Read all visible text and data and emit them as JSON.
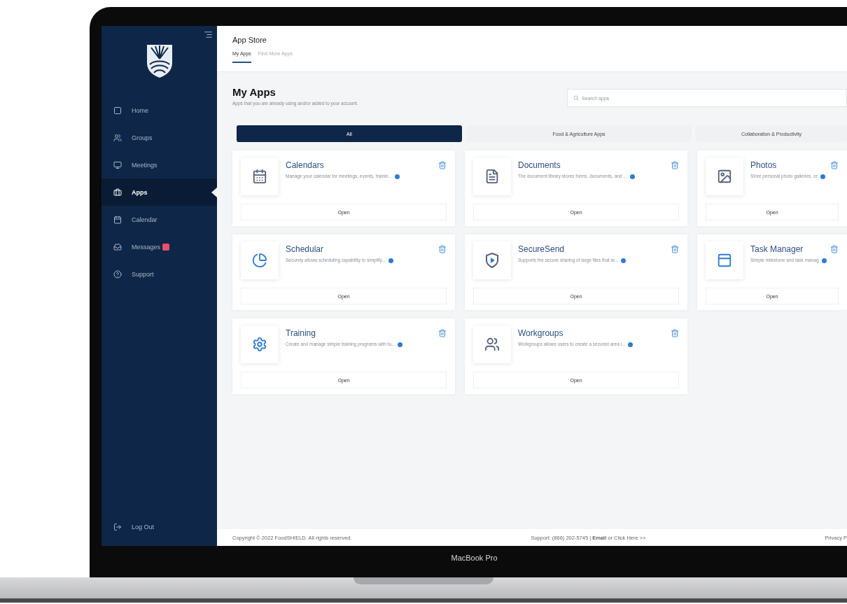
{
  "sidebar": {
    "items": [
      {
        "label": "Home",
        "kind": "home",
        "selected": false,
        "badge": false
      },
      {
        "label": "Groups",
        "kind": "groups",
        "selected": false,
        "badge": false
      },
      {
        "label": "Meetings",
        "kind": "meetings",
        "selected": false,
        "badge": false
      },
      {
        "label": "Apps",
        "kind": "apps",
        "selected": true,
        "badge": false
      },
      {
        "label": "Calendar",
        "kind": "calendar",
        "selected": false,
        "badge": false
      },
      {
        "label": "Messages",
        "kind": "messages",
        "selected": false,
        "badge": true
      },
      {
        "label": "Support",
        "kind": "support",
        "selected": false,
        "badge": false
      }
    ],
    "logout": "Log Out"
  },
  "header": {
    "title": "App Store",
    "tabs": [
      {
        "label": "My Apps",
        "selected": true
      },
      {
        "label": "Find More Apps",
        "selected": false
      }
    ]
  },
  "section": {
    "title": "My Apps",
    "subtitle": "Apps that you are already using and/or added to your account.",
    "search": {
      "placeholder": "Search apps"
    }
  },
  "categories": [
    {
      "label": "All",
      "selected": true
    },
    {
      "label": "Food & Agriculture Apps",
      "selected": false
    },
    {
      "label": "Collaboration & Productivity",
      "selected": false
    }
  ],
  "apps": [
    {
      "name": "Calendars",
      "kind": "calendar",
      "description": "Manage your calendar for meetings, events, trainin...",
      "button": "Open"
    },
    {
      "name": "Documents",
      "kind": "document",
      "description": "The document library stores forms, documents, and ...",
      "button": "Open"
    },
    {
      "name": "Photos",
      "kind": "photo",
      "description": "Store personal photo galleries, or",
      "button": "Open"
    },
    {
      "name": "Schedular",
      "kind": "scheduler",
      "description": "Securely allows scheduling capability to simplify...",
      "button": "Open"
    },
    {
      "name": "SecureSend",
      "kind": "securesend",
      "description": "Supports the secure sharing of large files that ar...",
      "button": "Open"
    },
    {
      "name": "Task Manager",
      "kind": "tasks",
      "description": "Simple milestone and task manag",
      "button": "Open"
    },
    {
      "name": "Training",
      "kind": "training",
      "description": "Create and manage simple training programs with fu...",
      "button": "Open"
    },
    {
      "name": "Workgroups",
      "kind": "workgroups",
      "description": "Workgroups allows users to create a secured area i...",
      "button": "Open"
    }
  ],
  "footer": {
    "copyright": "Copyright © 2022 FoodSHIELD. All rights reserved.",
    "support": "Support: (866) 202-5745 | **Email** or Click Here >>",
    "privacy": "Privacy P"
  },
  "device": {
    "label": "MacBook Pro"
  }
}
